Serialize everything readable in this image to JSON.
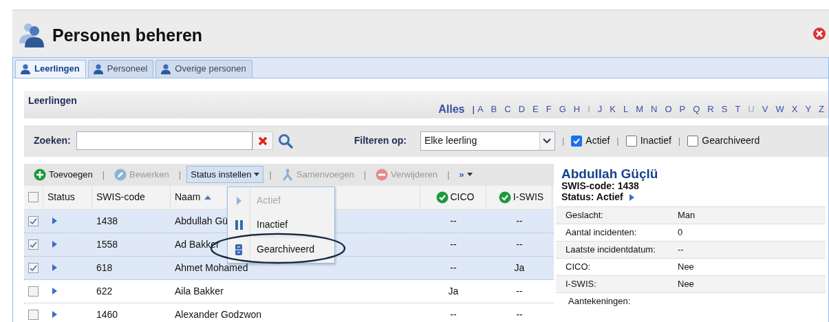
{
  "window": {
    "title": "Personen beheren"
  },
  "tabs": [
    {
      "label": "Leerlingen",
      "selected": true
    },
    {
      "label": "Personeel",
      "selected": false
    },
    {
      "label": "Overige personen",
      "selected": false
    }
  ],
  "section": {
    "title": "Leerlingen",
    "all_label": "Alles",
    "separator": "|",
    "letters": [
      {
        "label": "A",
        "disabled": false
      },
      {
        "label": "B",
        "disabled": false
      },
      {
        "label": "C",
        "disabled": false
      },
      {
        "label": "D",
        "disabled": false
      },
      {
        "label": "E",
        "disabled": false
      },
      {
        "label": "F",
        "disabled": false
      },
      {
        "label": "G",
        "disabled": false
      },
      {
        "label": "H",
        "disabled": false
      },
      {
        "label": "I",
        "disabled": true
      },
      {
        "label": "J",
        "disabled": false
      },
      {
        "label": "K",
        "disabled": false
      },
      {
        "label": "L",
        "disabled": false
      },
      {
        "label": "M",
        "disabled": false
      },
      {
        "label": "N",
        "disabled": false
      },
      {
        "label": "O",
        "disabled": false
      },
      {
        "label": "P",
        "disabled": false
      },
      {
        "label": "Q",
        "disabled": false
      },
      {
        "label": "R",
        "disabled": false
      },
      {
        "label": "S",
        "disabled": false
      },
      {
        "label": "T",
        "disabled": false
      },
      {
        "label": "U",
        "disabled": true
      },
      {
        "label": "V",
        "disabled": false
      },
      {
        "label": "W",
        "disabled": false
      },
      {
        "label": "X",
        "disabled": false
      },
      {
        "label": "Y",
        "disabled": false
      },
      {
        "label": "Z",
        "disabled": false
      }
    ]
  },
  "search": {
    "label": "Zoeken:"
  },
  "filter": {
    "label": "Filteren op:",
    "value": "Elke leerling",
    "options": [
      {
        "separator": "|",
        "label": "Actief",
        "checked": true
      },
      {
        "separator": "|",
        "label": "Inactief",
        "checked": false
      },
      {
        "separator": "|",
        "label": "Gearchiveerd",
        "checked": false
      }
    ]
  },
  "toolbar": [
    {
      "kind": "add",
      "label": "Toevoegen",
      "disabled": false,
      "expanded": false
    },
    {
      "separator": "|",
      "kind": "edit",
      "label": "Bewerken",
      "disabled": true,
      "expanded": false
    },
    {
      "separator": "|",
      "kind": "dropdown",
      "label": "Status instellen",
      "disabled": false,
      "expanded": true
    },
    {
      "separator": "|",
      "kind": "merge",
      "label": "Samenvoegen",
      "disabled": true,
      "expanded": false
    },
    {
      "separator": "|",
      "kind": "delete",
      "label": "Verwijderen",
      "disabled": true,
      "expanded": false
    },
    {
      "separator": "|",
      "kind": "more",
      "label": "»",
      "disabled": false,
      "expanded": false
    }
  ],
  "table": {
    "all_checked": false,
    "columns": [
      {
        "label": "Status",
        "kind": "text"
      },
      {
        "label": "SWIS-code",
        "kind": "text"
      },
      {
        "label": "Naam",
        "kind": "sorted"
      },
      {
        "label": "CICO",
        "kind": "check"
      },
      {
        "label": "I-SWIS",
        "kind": "check"
      }
    ],
    "rows": [
      {
        "selected": true,
        "swis": "1438",
        "name": "Abdullah Gü",
        "cico": "--",
        "iswis": "--"
      },
      {
        "selected": true,
        "swis": "1558",
        "name": "Ad Bakker",
        "cico": "--",
        "iswis": "--"
      },
      {
        "selected": true,
        "swis": "618",
        "name": "Ahmet Mohamed",
        "cico": "--",
        "iswis": "Ja"
      },
      {
        "selected": false,
        "swis": "622",
        "name": "Aila Bakker",
        "cico": "Ja",
        "iswis": "--"
      },
      {
        "selected": false,
        "swis": "1460",
        "name": "Alexander Godzwon",
        "cico": "--",
        "iswis": "--"
      }
    ]
  },
  "status_menu": [
    {
      "kind": "play",
      "label": "Actief",
      "disabled": true
    },
    {
      "kind": "pause",
      "label": "Inactief",
      "disabled": false
    },
    {
      "kind": "archive",
      "label": "Gearchiveerd",
      "disabled": false
    }
  ],
  "detail": {
    "name": "Abdullah Güçlü",
    "code": "SWIS-code: 1438",
    "status": "Status: Actief",
    "fields": [
      {
        "label": "Geslacht:",
        "value": "Man"
      },
      {
        "label": "Aantal incidenten:",
        "value": "0"
      },
      {
        "label": "Laatste incidentdatum:",
        "value": "--"
      },
      {
        "label": "CICO:",
        "value": "Nee"
      },
      {
        "label": "I-SWIS:",
        "value": "Nee"
      }
    ],
    "notes_label": "Aantekeningen:"
  }
}
